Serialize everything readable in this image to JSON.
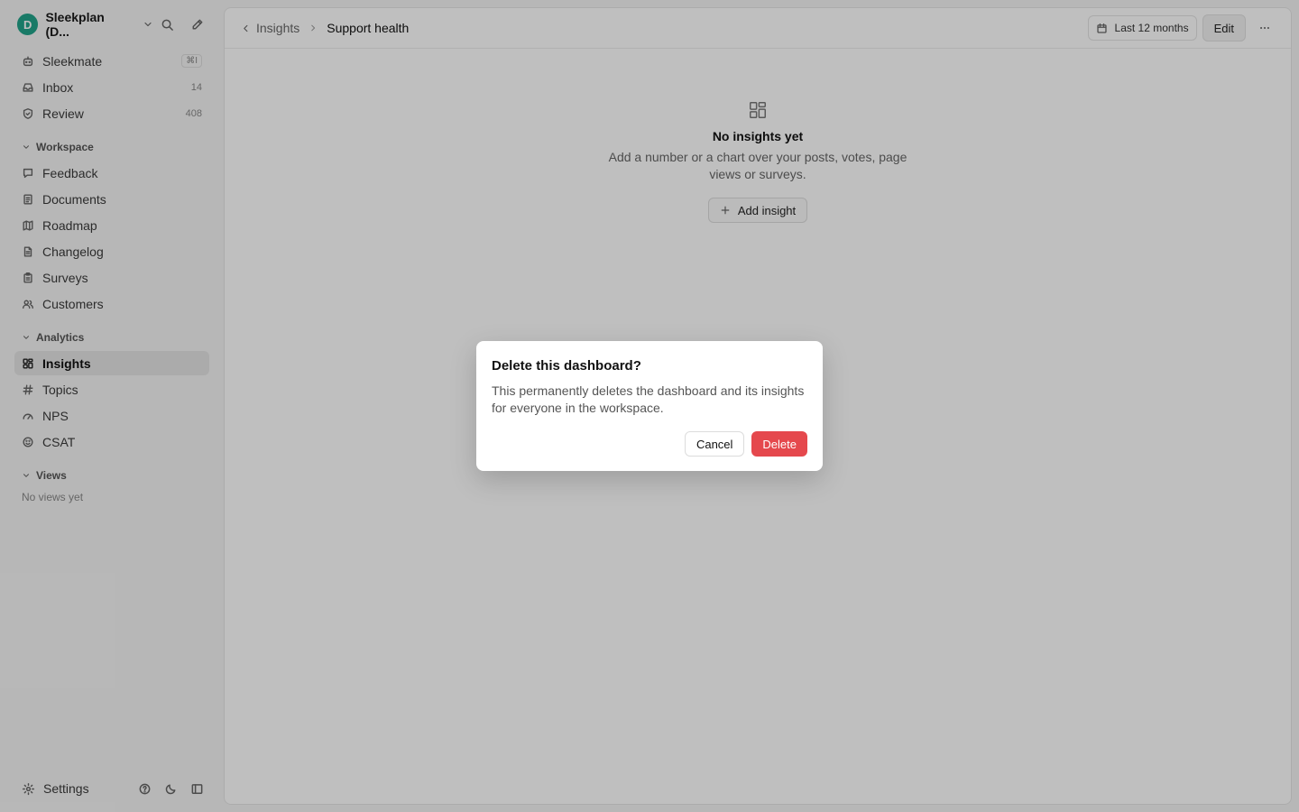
{
  "workspace": {
    "avatar_letter": "D",
    "name": "Sleekplan (D...",
    "avatar_color": "#22a38a"
  },
  "sidebar": {
    "top_items": [
      {
        "label": "Sleekmate",
        "badge": "⌘I",
        "icon": "bot-icon"
      },
      {
        "label": "Inbox",
        "badge": "14",
        "icon": "inbox-icon"
      },
      {
        "label": "Review",
        "badge": "408",
        "icon": "shield-check-icon"
      }
    ],
    "workspace_section": {
      "label": "Workspace",
      "items": [
        {
          "label": "Feedback",
          "icon": "message-icon"
        },
        {
          "label": "Documents",
          "icon": "documents-icon"
        },
        {
          "label": "Roadmap",
          "icon": "map-icon"
        },
        {
          "label": "Changelog",
          "icon": "file-text-icon"
        },
        {
          "label": "Surveys",
          "icon": "clipboard-icon"
        },
        {
          "label": "Customers",
          "icon": "users-icon"
        }
      ]
    },
    "analytics_section": {
      "label": "Analytics",
      "items": [
        {
          "label": "Insights",
          "icon": "grid-icon",
          "active": true
        },
        {
          "label": "Topics",
          "icon": "hash-icon"
        },
        {
          "label": "NPS",
          "icon": "gauge-icon"
        },
        {
          "label": "CSAT",
          "icon": "smile-icon"
        }
      ]
    },
    "views_section": {
      "label": "Views",
      "empty": "No views yet"
    },
    "footer": {
      "settings_label": "Settings"
    }
  },
  "topbar": {
    "breadcrumb_parent": "Insights",
    "breadcrumb_current": "Support health",
    "date_range": "Last 12 months",
    "edit_label": "Edit"
  },
  "empty_state": {
    "title": "No insights yet",
    "description": "Add a number or a chart over your posts, votes, page views or surveys.",
    "add_label": "Add insight"
  },
  "dialog": {
    "title": "Delete this dashboard?",
    "body": "This permanently deletes the dashboard and its insights for everyone in the workspace.",
    "cancel_label": "Cancel",
    "delete_label": "Delete",
    "delete_color": "#e5484d"
  }
}
